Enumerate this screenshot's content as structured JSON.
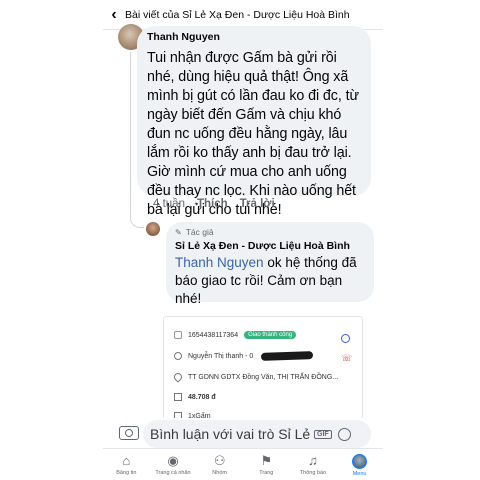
{
  "header": {
    "title": "Bài viết của Sỉ Lẻ Xạ Đen - Dược Liệu Hoà Bình"
  },
  "comment": {
    "author": "Thanh Nguyen",
    "text": "Tui nhận được Gấm bà gửi rồi nhé, dùng hiệu quả thật! Ông xã mình bị gút có lần đau ko đi đc, từ ngày biết đến Gấm và chịu khó đun nc uống đều hằng ngày, lâu lắm rồi ko thấy anh bị đau trở lại. Giờ mình cứ mua cho anh uống đều thay nc lọc. Khi nào uống hết bà lại gửi cho tui nhé!",
    "time": "4 tuần",
    "like_label": "Thích",
    "reply_label": "Trả lời"
  },
  "reply": {
    "badge": "Tác giả",
    "author": "Sỉ Lẻ Xạ Đen - Dược Liệu Hoà Bình",
    "mention": "Thanh Nguyen",
    "text": " ok hệ thống đã báo giao tc rồi! Cảm ơn bạn nhé!"
  },
  "order": {
    "code": "1654438117364",
    "status": "Giao thành công",
    "recipient": "Nguyễn Thị thanh - 0",
    "address": "TT GDNN GDTX Đồng Văn, THỊ TRẤN ĐỒNG...",
    "amount": "48.708 đ",
    "item": "1xGấm"
  },
  "composer": {
    "placeholder": "Bình luận với vai trò Sỉ Lẻ...",
    "gif": "GIF"
  },
  "nav": {
    "items": [
      {
        "label": "Bảng tin",
        "icon": "home-icon"
      },
      {
        "label": "Trang cá nhân",
        "icon": "profile-icon"
      },
      {
        "label": "Nhóm",
        "icon": "groups-icon"
      },
      {
        "label": "Trang",
        "icon": "flag-icon"
      },
      {
        "label": "Thông báo",
        "icon": "bell-icon"
      },
      {
        "label": "Menu",
        "icon": "menu-avatar"
      }
    ]
  }
}
